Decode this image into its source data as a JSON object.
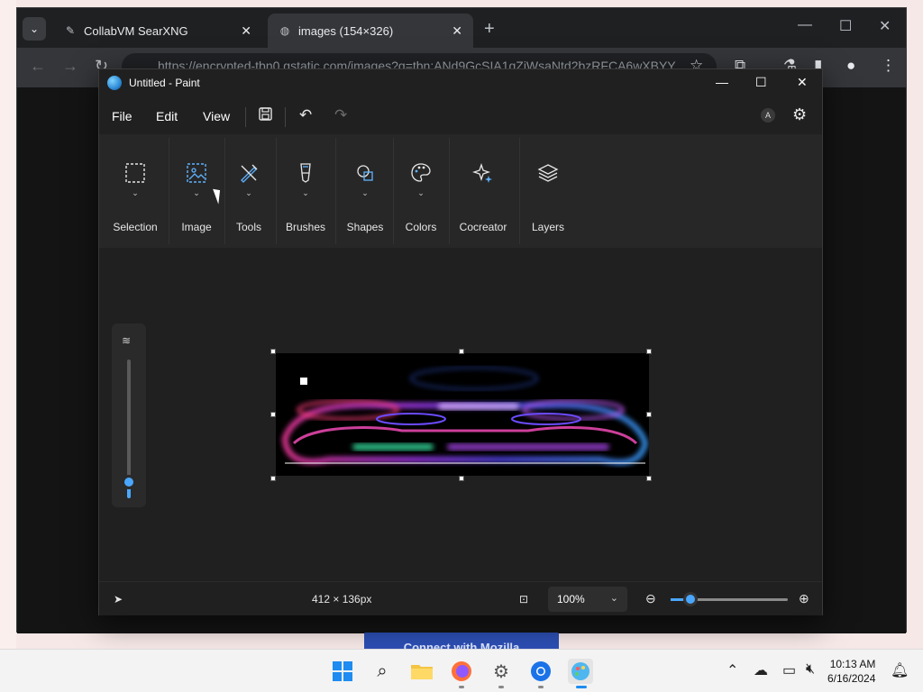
{
  "browser": {
    "tabs": [
      {
        "label": "CollabVM SearXNG",
        "icon": "searxng-icon",
        "active": false
      },
      {
        "label": "images (154×326)",
        "icon": "globe-icon",
        "active": true
      }
    ],
    "url": "https://encrypted-tbn0.gstatic.com/images?q=tbn:ANd9GcSIA1qZiWsaNtd2bzRFCA6wXBYY",
    "page_button_label": "Connect with Mozilla"
  },
  "paint": {
    "title": "Untitled - Paint",
    "menu": [
      "File",
      "Edit",
      "View"
    ],
    "account_initial": "A",
    "ribbon_groups": [
      {
        "label": "Selection",
        "icon": "selection-icon"
      },
      {
        "label": "Image",
        "icon": "image-icon"
      },
      {
        "label": "Tools",
        "icon": "tools-icon"
      },
      {
        "label": "Brushes",
        "icon": "brush-icon"
      },
      {
        "label": "Shapes",
        "icon": "shapes-icon"
      },
      {
        "label": "Colors",
        "icon": "palette-icon"
      },
      {
        "label": "Cocreator",
        "icon": "sparkle-icon"
      },
      {
        "label": "Layers",
        "icon": "layers-icon"
      }
    ],
    "canvas_size": "412 × 136px",
    "zoom": "100%",
    "zoom_fraction": 0.17,
    "brush_size_fraction": 0.1
  },
  "taskbar": {
    "time": "10:13 AM",
    "date": "6/16/2024"
  },
  "colors": {
    "accent": "#4aa7ff",
    "paint_bg": "#202020",
    "ribbon_bg": "#272727"
  }
}
